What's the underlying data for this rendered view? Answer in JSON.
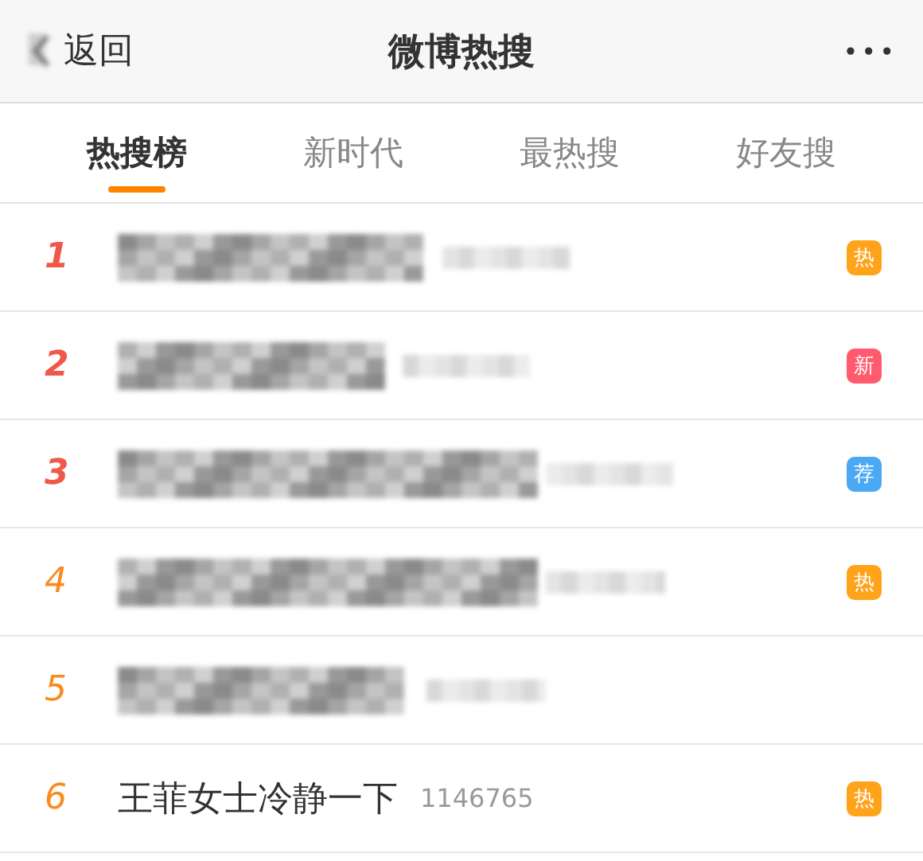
{
  "header": {
    "back_label": "返回",
    "title": "微博热搜",
    "more": "•••"
  },
  "tabs": [
    {
      "label": "热搜榜",
      "selected": true
    },
    {
      "label": "新时代",
      "selected": false
    },
    {
      "label": "最热搜",
      "selected": false
    },
    {
      "label": "好友搜",
      "selected": false
    }
  ],
  "items": [
    {
      "rank": "1",
      "color": "#f0584a",
      "kind": "blurred",
      "badge": {
        "text": "热",
        "color": "#ffa31a"
      }
    },
    {
      "rank": "2",
      "color": "#f0584a",
      "kind": "blurred",
      "badge": {
        "text": "新",
        "color": "#ff5a6e"
      }
    },
    {
      "rank": "3",
      "color": "#f0584a",
      "kind": "blurred",
      "badge": {
        "text": "荐",
        "color": "#4aa8f5"
      }
    },
    {
      "rank": "4",
      "color": "#fa8a1e",
      "kind": "blurred",
      "badge": {
        "text": "热",
        "color": "#ffa31a"
      }
    },
    {
      "rank": "5",
      "color": "#fa8a1e",
      "kind": "blurred"
    },
    {
      "rank": "6",
      "color": "#fa8a1e",
      "kind": "text",
      "title": "王菲女士冷静一下",
      "count": "1146765",
      "badge": {
        "text": "热",
        "color": "#ffa31a"
      }
    }
  ]
}
